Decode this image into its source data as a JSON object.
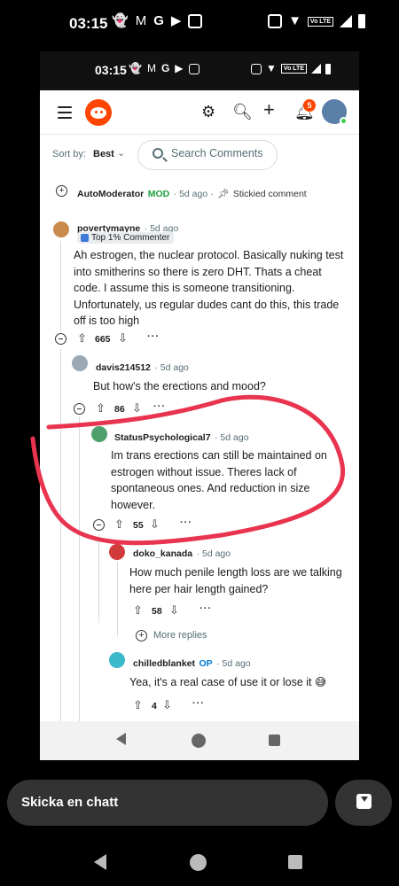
{
  "outer_status": {
    "time": "03:15",
    "lte": "Vo LTE"
  },
  "inner_status": {
    "time": "03:15",
    "lte": "Vo LTE"
  },
  "header": {
    "notifications_count": "5"
  },
  "sort": {
    "label": "Sort by:",
    "value": "Best",
    "search_placeholder": "Search Comments"
  },
  "comments": {
    "automod": {
      "user": "AutoModerator",
      "tag": "MOD",
      "time": "· 5d ago ·",
      "stickied": "Stickied comment"
    },
    "c1": {
      "user": "povertymayne",
      "time": "· 5d ago",
      "flair": "Top 1% Commenter",
      "body": "Ah estrogen, the nuclear protocol. Basically nuking test into smitherins so there is zero DHT. Thats a cheat code. I assume this is someone transitioning. Unfortunately, us regular dudes cant do this, this trade off is too high",
      "score": "665"
    },
    "c2": {
      "user": "davis214512",
      "time": "· 5d ago",
      "body": "But how's the erections and mood?",
      "score": "86"
    },
    "c3": {
      "user": "StatusPsychological7",
      "time": "· 5d ago",
      "body": "Im trans erections can still be maintained on estrogen without issue. Theres lack of spontaneous ones. And reduction in size however.",
      "score": "55"
    },
    "c4": {
      "user": "doko_kanada",
      "time": "· 5d ago",
      "body": "How much penile length loss are we talking here per hair length gained?",
      "score": "58",
      "more_replies": "More replies"
    },
    "c5": {
      "user": "chilledblanket",
      "tag": "OP",
      "time": "· 5d ago",
      "body": "Yea, it's a real case of use it or lose it 😅",
      "score": "4"
    }
  },
  "chat": {
    "placeholder": "Skicka en chatt"
  },
  "colors": {
    "reddit_orange": "#ff4500",
    "annotation_red": "#e8344e",
    "mod_green": "#1a9d3c",
    "op_blue": "#0079d3"
  }
}
